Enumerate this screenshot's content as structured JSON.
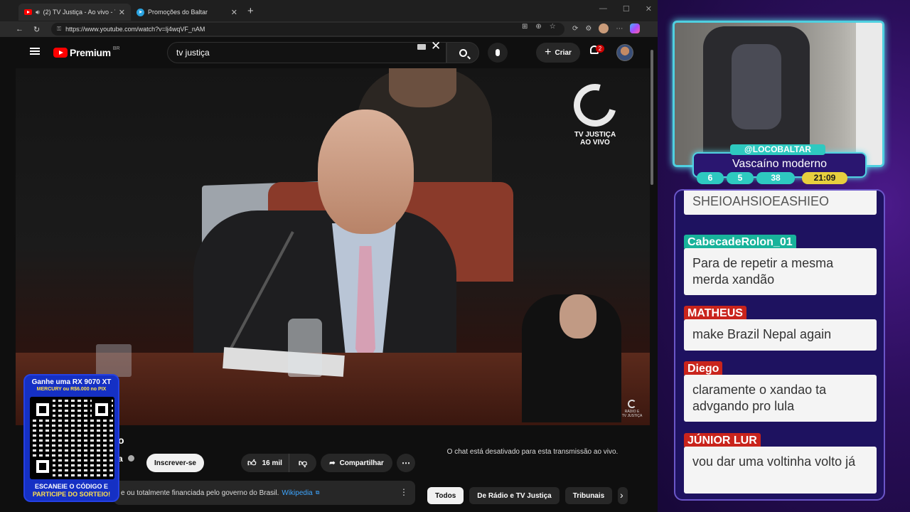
{
  "browser": {
    "tabs": [
      {
        "label": "(2) TV Justiça - Ao vivo - You",
        "active": true
      },
      {
        "label": "Promoções do Baltar",
        "active": false
      }
    ],
    "new_tab": "+",
    "url": "https://www.youtube.com/watch?v=lj4wqVF_nAM",
    "window_controls": [
      "—",
      "☐",
      "✕"
    ]
  },
  "youtube": {
    "logo_word": "Premium",
    "country_code": "BR",
    "search_value": "tv justiça",
    "create_label": "Criar",
    "notification_count": "2",
    "video_logo": {
      "line1": "TV JUSTIÇA",
      "line2": "AO VIVO"
    },
    "video_corner_logo": {
      "line1": "RÁDIO E",
      "line2": "TV JUSTIÇA"
    },
    "title_fragment": "o",
    "channel_fragment": "a",
    "subscribe_label": "Inscrever-se",
    "likes": "16 mil",
    "share_label": "Compartilhar",
    "info_text": "e ou totalmente financiada pelo governo do Brasil.",
    "info_link": "Wikipedia",
    "chat_disabled": "O chat está desativado para esta transmissão ao vivo.",
    "chips": [
      {
        "label": "Todos",
        "active": true
      },
      {
        "label": "De Rádio e TV Justiça",
        "active": false
      },
      {
        "label": "Tribunais",
        "active": false
      }
    ]
  },
  "promo": {
    "headline": "Ganhe uma RX 9070 XT",
    "subline": "MERCURY ou R$6.000 no PIX",
    "footer_line1": "ESCANEIE O CÓDIGO E",
    "footer_line2": "PARTICIPE DO SORTEIO!"
  },
  "stream": {
    "handle": "@LOCOBALTAR",
    "status": "Vascaíno moderno",
    "stats": [
      {
        "value": "6"
      },
      {
        "value": "5"
      },
      {
        "value": "38"
      },
      {
        "value": "21:09"
      }
    ],
    "chat": [
      {
        "name": "",
        "text": "SHEIOAHSIOEASHIEO"
      },
      {
        "name": "CabecadeRolon_01",
        "text": "Para de repetir a mesma merda xandão"
      },
      {
        "name": "MATHEUS",
        "text": "make Brazil Nepal again"
      },
      {
        "name": "Diego",
        "text": "claramente o xandao ta advgando pro lula"
      },
      {
        "name": "JÚNIOR LUR",
        "text": "vou dar uma voltinha volto já"
      }
    ]
  },
  "colors": {
    "accent_teal": "#2ec9c0",
    "accent_yellow": "#e7cf3e",
    "name_red": "#c9241c",
    "youtube_red": "#ff0000",
    "overlay_purple": "#2a0e5a"
  }
}
